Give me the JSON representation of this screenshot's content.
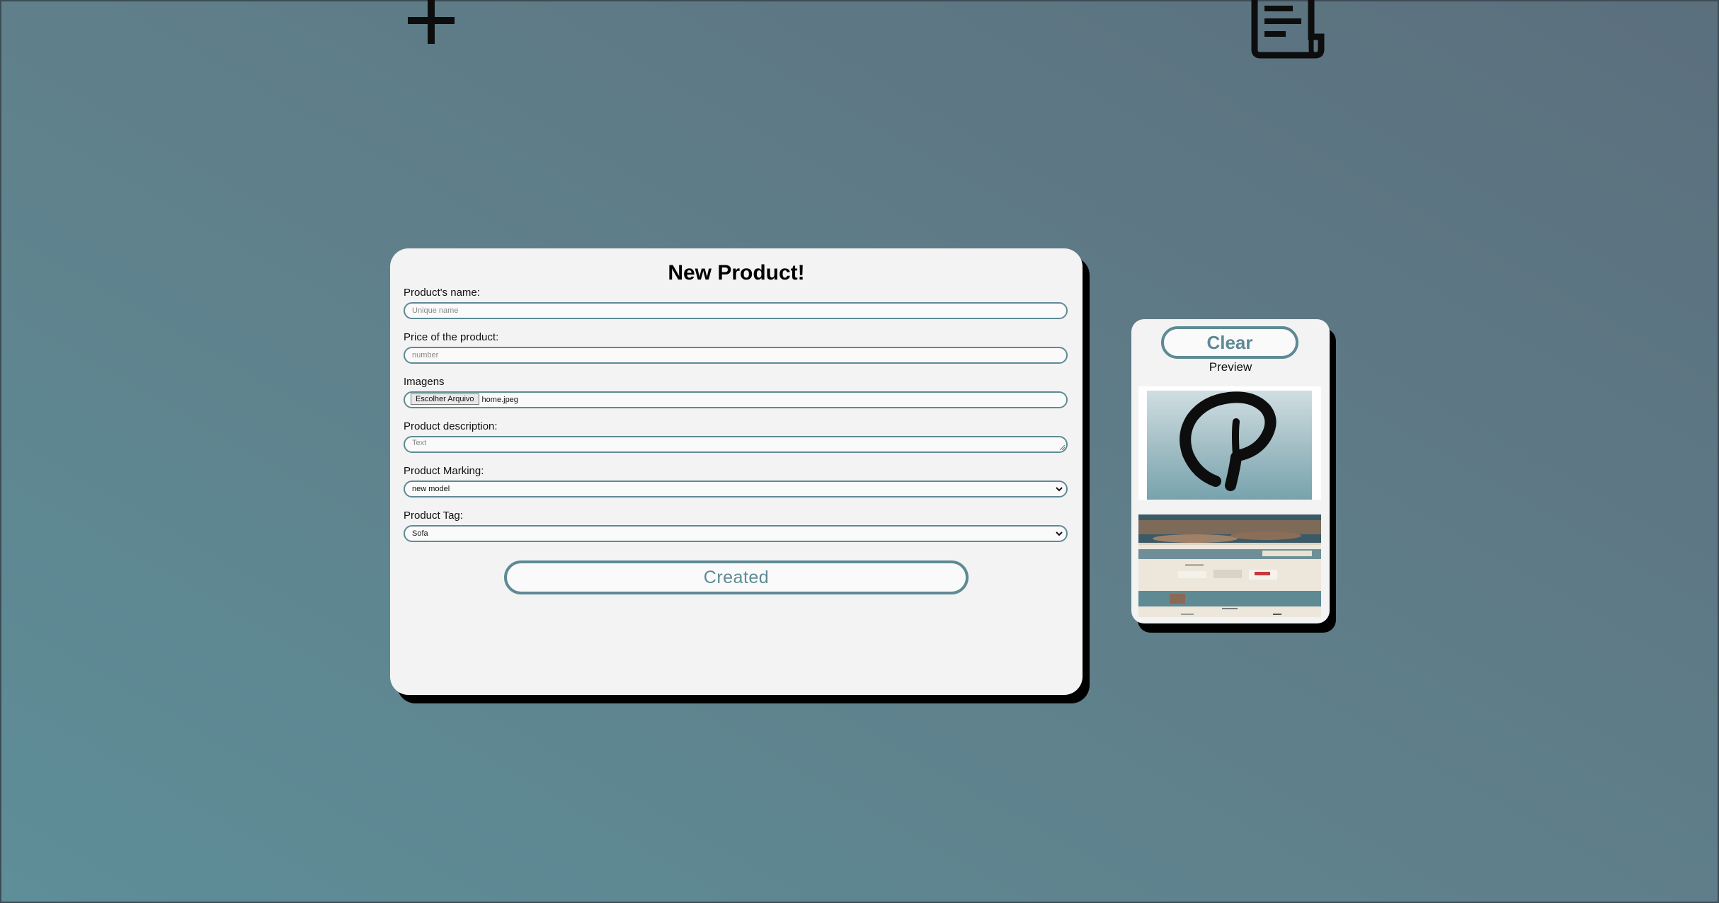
{
  "icons": {
    "plus": "plus-icon",
    "document": "document-icon"
  },
  "form": {
    "title": "New Product!",
    "name_label": "Product's name:",
    "name_placeholder": "Unique name",
    "price_label": "Price of the product:",
    "price_placeholder": "number",
    "images_label": "Imagens",
    "file_button": "Escolher Arquivo",
    "file_name": "home.jpeg",
    "description_label": "Product description:",
    "description_placeholder": "Text",
    "marking_label": "Product Marking:",
    "marking_value": "new model",
    "tag_label": "Product Tag:",
    "tag_value": "Sofa",
    "submit_label": "Created"
  },
  "preview": {
    "clear_label": "Clear",
    "title": "Preview"
  },
  "colors": {
    "accent": "#5e8a94",
    "card": "#f3f3f3",
    "shadow": "#000000"
  }
}
